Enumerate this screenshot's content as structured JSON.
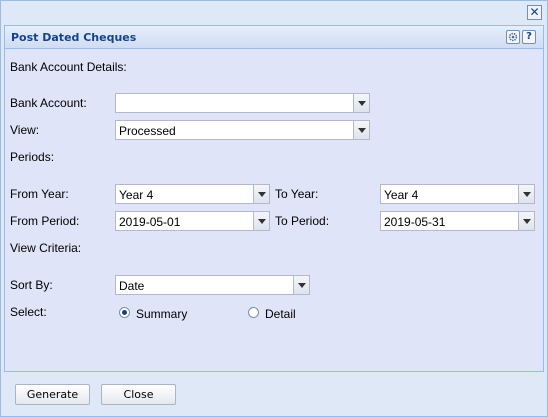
{
  "window": {
    "close_glyph": "✕"
  },
  "panel": {
    "title": "Post Dated Cheques",
    "tools": {
      "settings_icon": "gear-icon",
      "help_glyph": "?"
    }
  },
  "form": {
    "bank_account_details_heading": "Bank Account Details:",
    "bank_account": {
      "label": "Bank Account:",
      "value": ""
    },
    "view": {
      "label": "View:",
      "value": "Processed"
    },
    "periods_heading": "Periods:",
    "from_year": {
      "label": "From Year:",
      "value": "Year 4"
    },
    "to_year": {
      "label": "To Year:",
      "value": "Year 4"
    },
    "from_period": {
      "label": "From Period:",
      "value": "2019-05-01"
    },
    "to_period": {
      "label": "To Period:",
      "value": "2019-05-31"
    },
    "view_criteria_heading": "View Criteria:",
    "sort_by": {
      "label": "Sort By:",
      "value": "Date"
    },
    "select": {
      "label": "Select:",
      "options": [
        {
          "label": "Summary",
          "checked": true
        },
        {
          "label": "Detail",
          "checked": false
        }
      ]
    }
  },
  "footer": {
    "generate_label": "Generate",
    "close_label": "Close"
  }
}
